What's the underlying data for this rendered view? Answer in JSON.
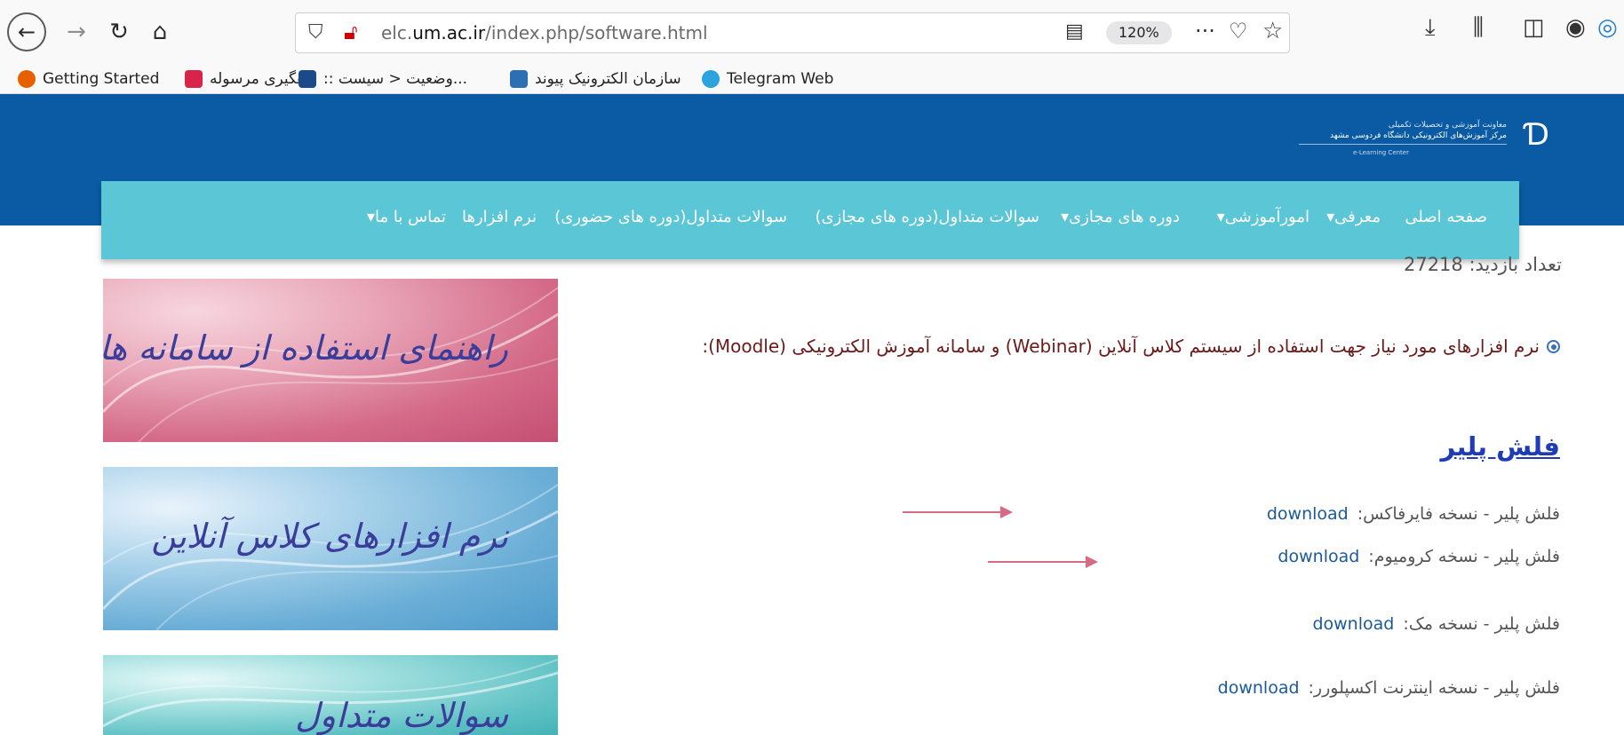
{
  "browser": {
    "url_prefix": "elc.",
    "url_domain": "um.ac.ir",
    "url_path": "/index.php/software.html",
    "zoom": "120%",
    "bookmarks": [
      {
        "label": "Getting Started",
        "color": "#e66000"
      },
      {
        "label": "رهگیری مرسوله",
        "color": "#d9234a"
      },
      {
        "label": ":: وضعیت < سیست...",
        "color": "#1a4a8a"
      },
      {
        "label": "سازمان الکترونیک پیوند",
        "color": "#2c6fb3"
      },
      {
        "label": "Telegram Web",
        "color": "#2aa3df"
      }
    ]
  },
  "site": {
    "header_color": "#0a5ba3",
    "nav_color": "#5ac6d6",
    "logo_line1": "معاونت آموزشی و تحصیلات تکمیلی",
    "logo_line2": "مرکز آموزش‌های الکترونیکی دانشگاه فردوسی مشهد",
    "logo_line3": "e-Learning Center",
    "nav": [
      {
        "label": "صفحه اصلی"
      },
      {
        "label": "معرفی▾"
      },
      {
        "label": "امورآموزشی▾"
      },
      {
        "label": "دوره های مجازی▾"
      },
      {
        "label": "سوالات متداول(دوره های مجازی)"
      },
      {
        "label": "سوالات متداول(دوره های حضوری)"
      },
      {
        "label": "نرم افزارها"
      },
      {
        "label": "تماس با ما▾"
      }
    ],
    "visits": "تعداد بازدید: 27218",
    "intro": "نرم افزارهای مورد نیاز جهت  استفاده از سیستم کلاس آنلاین (Webinar) و سامانه آموزش الکترونیکی (Moodle):",
    "heading": "فلش پلیر",
    "downloads": [
      {
        "label": "فلش پلیر - نسخه فایرفاکس:",
        "link": "download"
      },
      {
        "label": "فلش پلیر - نسخه کرومیوم:",
        "link": "download"
      },
      {
        "label": "فلش پلیر - نسخه مک:",
        "link": "download"
      },
      {
        "label": "فلش پلیر - نسخه اینترنت اکسپلورر:",
        "link": "download"
      }
    ],
    "banners": [
      {
        "text": "راهنمای استفاده از سامانه ها"
      },
      {
        "text": "نرم افزارهای کلاس آنلاین"
      },
      {
        "text": "سوالات متداول"
      }
    ]
  }
}
